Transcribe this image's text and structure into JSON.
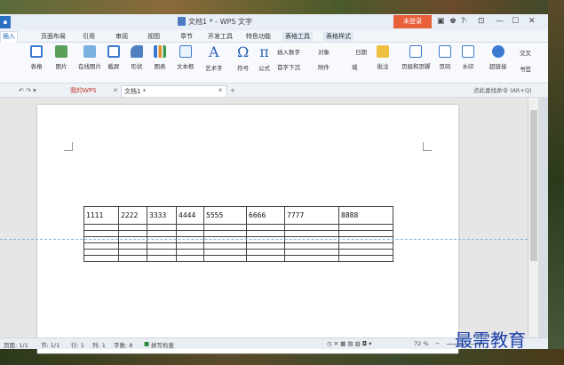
{
  "window": {
    "title": "文档1 * - WPS 文字",
    "login_label": "未登录",
    "quick_menu": "▪"
  },
  "ribbon_tabs": [
    "插入",
    "页面布局",
    "引用",
    "审阅",
    "视图",
    "章节",
    "开发工具",
    "特色功能",
    "表格工具",
    "表格样式"
  ],
  "ribbon_items": {
    "table": "表格",
    "picture": "图片",
    "online_picture": "在线图片",
    "screenshot": "截屏",
    "shape": "形状",
    "chart": "图表",
    "textbox": "文本框",
    "wordart": "艺术字",
    "symbol": "符号",
    "formula": "公式",
    "insert_number": "插入数字",
    "object": "对象",
    "date": "日期",
    "first_drop": "首字下沉",
    "attachment": "附件",
    "field": "域",
    "comment": "批注",
    "header_footer": "页眉和页脚",
    "page_number": "页码",
    "watermark": "水印",
    "hyperlink": "超链接",
    "cross_ref": "交叉",
    "bookmark": "书签"
  },
  "doc_tabs": {
    "home": "我的WPS",
    "current": "文档1 *",
    "new_tab": "+",
    "search_hint": "点此查找命令 (Alt+Q)"
  },
  "table": {
    "header": [
      "1111",
      "2222",
      "3333",
      "4444",
      "5555",
      "6666",
      "7777",
      "8888"
    ],
    "empty_rows": 6
  },
  "status": {
    "page": "页面: 1/1",
    "section": "节: 1/1",
    "row": "行: 1",
    "col": "列: 1",
    "words": "字数: 8",
    "spell": "拼写检查",
    "zoom": "72 %"
  },
  "overlay_watermark": "最需教育",
  "colors": {
    "accent": "#1f63b8",
    "login": "#e8603a",
    "watermark": "#1a3fa8"
  }
}
